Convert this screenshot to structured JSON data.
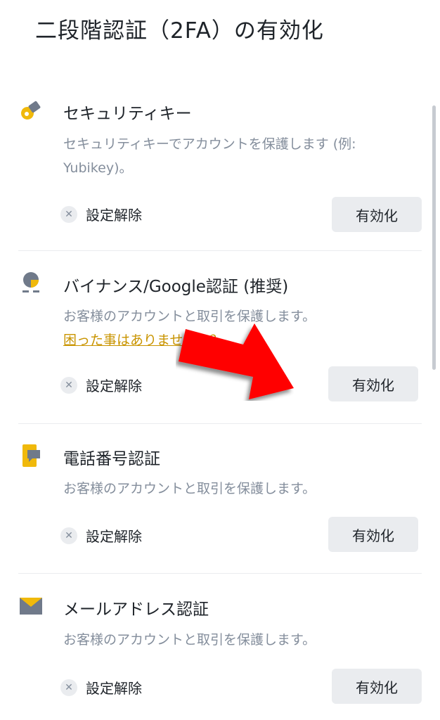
{
  "page": {
    "title": "二段階認証（2FA）の有効化"
  },
  "items": [
    {
      "title": "セキュリティキー",
      "description": "セキュリティキーでアカウントを保護します (例: Yubikey)。",
      "disable_label": "設定解除",
      "enable_label": "有効化",
      "icon": "security-key-icon"
    },
    {
      "title": "バイナンス/Google認証 (推奨)",
      "description": "お客様のアカウントと取引を保護します。",
      "help_link": "困った事はありませんか？",
      "disable_label": "設定解除",
      "enable_label": "有効化",
      "icon": "authenticator-icon"
    },
    {
      "title": "電話番号認証",
      "description": "お客様のアカウントと取引を保護します。",
      "disable_label": "設定解除",
      "enable_label": "有効化",
      "icon": "phone-icon"
    },
    {
      "title": "メールアドレス認証",
      "description": "お客様のアカウントと取引を保護します。",
      "disable_label": "設定解除",
      "enable_label": "有効化",
      "icon": "email-icon"
    }
  ],
  "colors": {
    "accent": "#f0b90b",
    "icon_gray": "#707a8a",
    "button_bg": "#eaecef",
    "link": "#c99400",
    "arrow": "#ff0000"
  },
  "annotation": {
    "icon": "red-arrow-icon"
  }
}
